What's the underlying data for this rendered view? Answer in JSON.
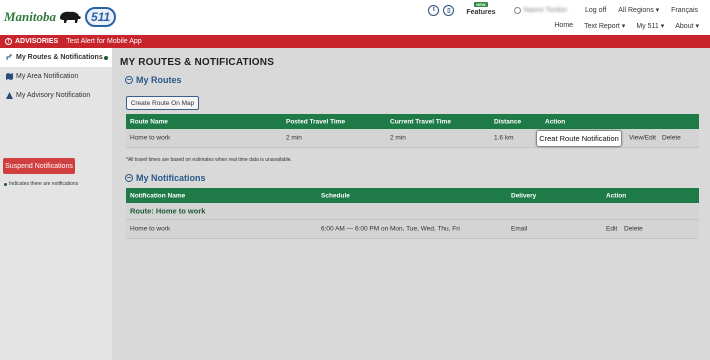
{
  "header": {
    "logo_text": "Manitoba",
    "badge_text": "511",
    "new_tag": "NEW",
    "features_label": "Features",
    "user_name": "Naomi Tordon",
    "logoff_label": "Log off",
    "regions_label": "All Regions ▾",
    "language_label": "Français",
    "nav": {
      "home": "Home",
      "text_report": "Text Report ▾",
      "my511": "My 511 ▾",
      "about": "About ▾"
    }
  },
  "advisories": {
    "title": "ADVISORIES",
    "message": "Test Alert for Mobile App"
  },
  "sidebar": {
    "items": [
      {
        "label": "My Routes & Notifications"
      },
      {
        "label": "My Area Notification"
      },
      {
        "label": "My Advisory Notification"
      }
    ],
    "suspend_label": "Suspend Notifications",
    "note": "Indicates there are notifications"
  },
  "main": {
    "page_title": "MY ROUTES & NOTIFICATIONS",
    "routes": {
      "title": "My Routes",
      "create_button": "Create Route On Map",
      "columns": [
        "Route Name",
        "Posted Travel Time",
        "Current Travel Time",
        "Distance",
        "Action"
      ],
      "rows": [
        {
          "name": "Home to work",
          "posted": "2 min",
          "current": "2 min",
          "distance": "1.6 km",
          "action_primary": "Creat Route Notification",
          "view_edit": "View/Edit",
          "delete": "Delete"
        }
      ],
      "footnote": "*All travel times are based on estimates when real time data is unavailable."
    },
    "notifications": {
      "title": "My Notifications",
      "columns": [
        "Notification Name",
        "Schedule",
        "Delivery",
        "Action"
      ],
      "group_label": "Route: Home to work",
      "rows": [
        {
          "name": "Home to work",
          "schedule": "6:00 AM — 6:00 PM on Mon, Tue, Wed, Thu, Fri",
          "delivery": "Email",
          "edit": "Edit",
          "delete": "Delete"
        }
      ]
    }
  },
  "colors": {
    "advisory_bar": "#c8242b",
    "table_header": "#1e7a47",
    "suspend_button": "#cf3f3f",
    "section_title": "#2a5a8a"
  }
}
